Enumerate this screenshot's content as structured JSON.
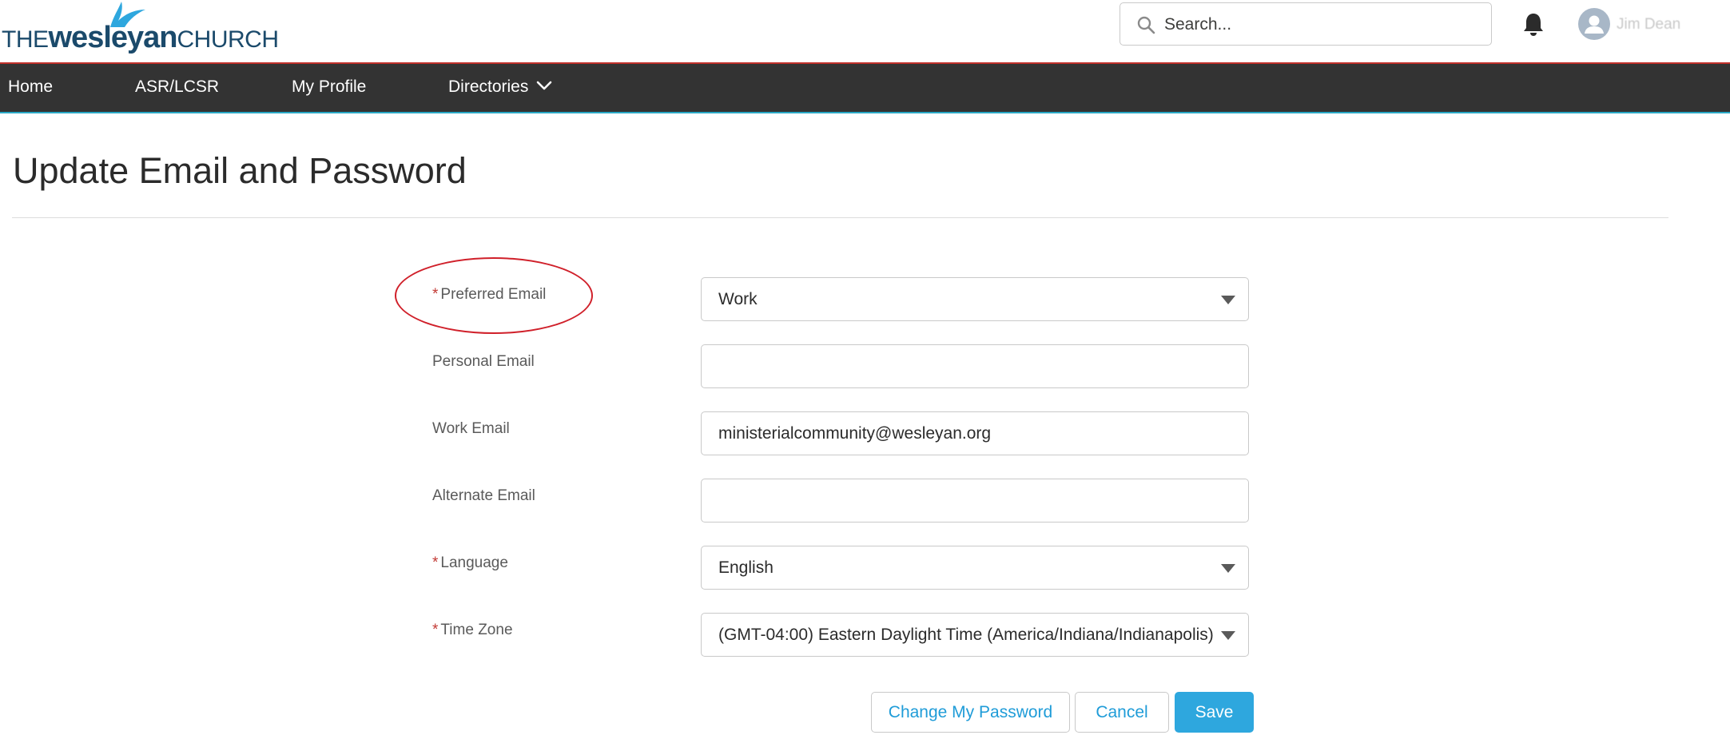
{
  "brand": {
    "logo_the": "THE",
    "logo_wesleyan": "wesleyan",
    "logo_church": "CHURCH",
    "primary_color": "#1b4a6b",
    "accent_color": "#2ea7de"
  },
  "header": {
    "search_placeholder": "Search...",
    "search_icon": "search-icon",
    "notification_icon": "bell-icon",
    "avatar_icon": "user-avatar-icon",
    "user_name": "Jim Dean"
  },
  "nav": {
    "background": "#333333",
    "items": [
      {
        "label": "Home"
      },
      {
        "label": "ASR/LCSR"
      },
      {
        "label": "My Profile"
      },
      {
        "label": "Directories",
        "icon": "chevron-down-icon"
      }
    ]
  },
  "page": {
    "title": "Update Email and Password"
  },
  "form": {
    "required_marker": "*",
    "preferred_email": {
      "label": "Preferred Email",
      "required": true,
      "value": "Work"
    },
    "personal_email": {
      "label": "Personal Email",
      "value": ""
    },
    "work_email": {
      "label": "Work Email",
      "value": "ministerialcommunity@wesleyan.org"
    },
    "alternate_email": {
      "label": "Alternate Email",
      "value": ""
    },
    "language": {
      "label": "Language",
      "required": true,
      "value": "English"
    },
    "time_zone": {
      "label": "Time Zone",
      "required": true,
      "value": "(GMT-04:00) Eastern Daylight Time (America/Indiana/Indianapolis)"
    }
  },
  "buttons": {
    "change_password": "Change My Password",
    "cancel": "Cancel",
    "save": "Save"
  }
}
